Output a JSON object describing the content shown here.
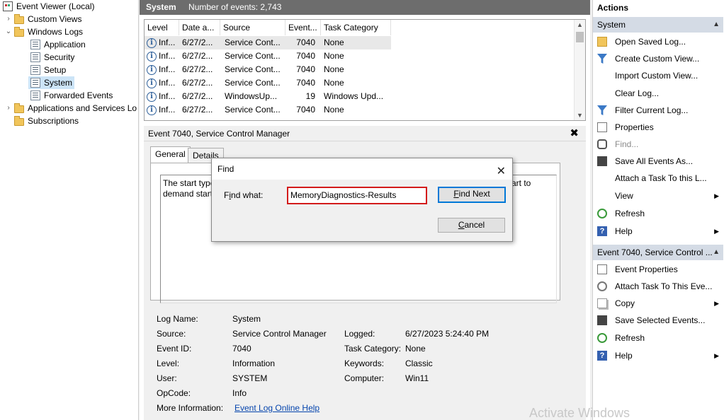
{
  "tree": {
    "root": "Event Viewer (Local)",
    "custom_views": "Custom Views",
    "windows_logs": "Windows Logs",
    "logs": [
      "Application",
      "Security",
      "Setup",
      "System",
      "Forwarded Events"
    ],
    "apps_services": "Applications and Services Lo",
    "subscriptions": "Subscriptions"
  },
  "center": {
    "log_name": "System",
    "count_text": "Number of events: 2,743",
    "columns": [
      "Level",
      "Date a...",
      "Source",
      "Event...",
      "Task Category"
    ],
    "rows": [
      {
        "level": "Inf...",
        "date": "6/27/2...",
        "source": "Service Cont...",
        "event": "7040",
        "category": "None"
      },
      {
        "level": "Inf...",
        "date": "6/27/2...",
        "source": "Service Cont...",
        "event": "7040",
        "category": "None"
      },
      {
        "level": "Inf...",
        "date": "6/27/2...",
        "source": "Service Cont...",
        "event": "7040",
        "category": "None"
      },
      {
        "level": "Inf...",
        "date": "6/27/2...",
        "source": "Service Cont...",
        "event": "7040",
        "category": "None"
      },
      {
        "level": "Inf...",
        "date": "6/27/2...",
        "source": "WindowsUp...",
        "event": "19",
        "category": "Windows Upd..."
      },
      {
        "level": "Inf...",
        "date": "6/27/2...",
        "source": "Service Cont...",
        "event": "7040",
        "category": "None"
      }
    ]
  },
  "detail": {
    "title": "Event 7040, Service Control Manager",
    "tabs": [
      "General",
      "Details"
    ],
    "desc_line1": "The start type",
    "desc_line1_end": "art to",
    "desc_line2": "demand start",
    "props": {
      "log_name_label": "Log Name:",
      "log_name": "System",
      "source_label": "Source:",
      "source": "Service Control Manager",
      "logged_label": "Logged:",
      "logged": "6/27/2023 5:24:40 PM",
      "event_id_label": "Event ID:",
      "event_id": "7040",
      "task_cat_label": "Task Category:",
      "task_cat": "None",
      "level_label": "Level:",
      "level": "Information",
      "keywords_label": "Keywords:",
      "keywords": "Classic",
      "user_label": "User:",
      "user": "SYSTEM",
      "computer_label": "Computer:",
      "computer": "Win11",
      "opcode_label": "OpCode:",
      "opcode": "Info",
      "more_info_label": "More Information:",
      "more_info_link": "Event Log Online Help"
    }
  },
  "find_dialog": {
    "title": "Find",
    "label": "Find what:",
    "value": "MemoryDiagnostics-Results",
    "find_next": "Find Next",
    "cancel": "Cancel"
  },
  "actions": {
    "title": "Actions",
    "section1": "System",
    "items1": [
      "Open Saved Log...",
      "Create Custom View...",
      "Import Custom View...",
      "Clear Log...",
      "Filter Current Log...",
      "Properties",
      "Find...",
      "Save All Events As...",
      "Attach a Task To this L...",
      "View",
      "Refresh",
      "Help"
    ],
    "section2": "Event 7040, Service Control ...",
    "items2": [
      "Event Properties",
      "Attach Task To This Eve...",
      "Copy",
      "Save Selected Events...",
      "Refresh",
      "Help"
    ]
  },
  "watermark": "Activate Windows",
  "colors": {
    "accent": "#0078d7",
    "highlight_red": "#d31b1b",
    "selection": "#cce4f7",
    "header_gray": "#6d6d6d"
  }
}
